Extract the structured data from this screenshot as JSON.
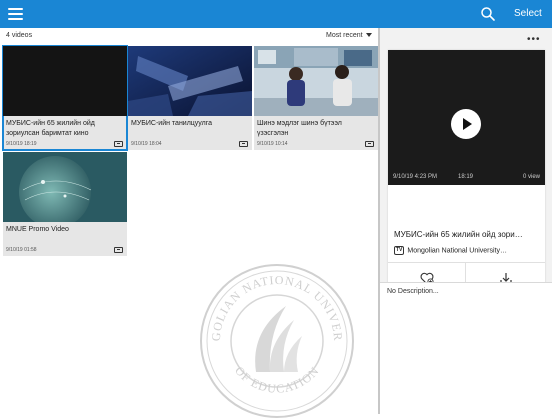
{
  "topbar": {
    "menu_icon": "hamburger-icon",
    "search_icon": "search-icon",
    "select_label": "Select",
    "color": "#1a86d4"
  },
  "list": {
    "count_label": "4 videos",
    "sort_label": "Most recent",
    "videos": [
      {
        "title": "МУБИС-ийн 65 жилийн ойд зориулсан баримтат кино",
        "date": "9/10/19 18:19",
        "selected": true
      },
      {
        "title": "МУБИС-ийн танилцуулга",
        "date": "9/10/19 18:04",
        "selected": false
      },
      {
        "title": "Шинэ мэдлэг шинэ бүтээл үзэсгэлэн",
        "date": "9/10/19 10:14",
        "selected": false
      },
      {
        "title": "MNUE Promo Video",
        "date": "9/10/19 01:58",
        "selected": false
      }
    ]
  },
  "detail": {
    "date": "9/10/19 4:23 PM",
    "duration": "18:19",
    "views": "0 view",
    "title": "МУБИС-ийн 65 жилийн ойд зори…",
    "channel_badge": "TV",
    "channel": "Mongolian National University…",
    "description": "No Description..."
  },
  "watermark": {
    "top_text": "MONGOLIAN NATIONAL UNIVERSITY",
    "bottom_text": "OF EDUCATION"
  }
}
